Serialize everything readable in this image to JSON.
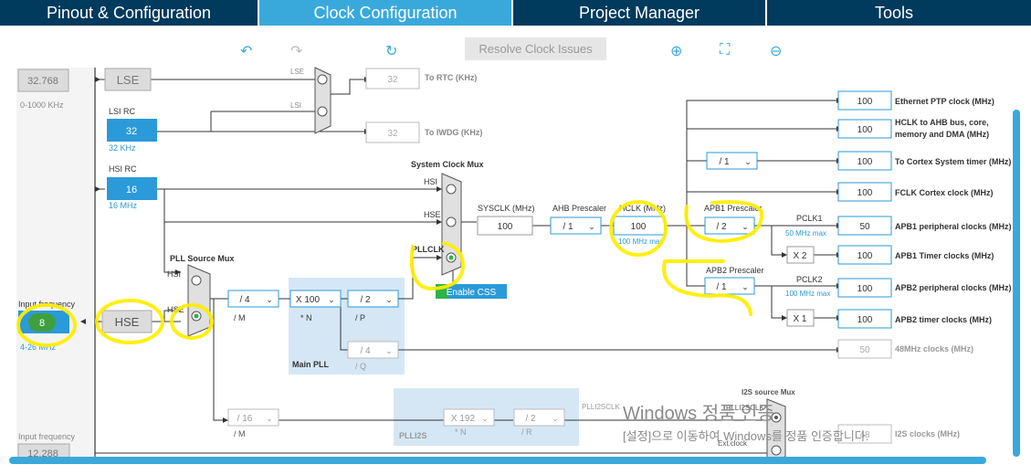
{
  "tabs": [
    {
      "label": "Pinout & Configuration"
    },
    {
      "label": "Clock Configuration"
    },
    {
      "label": "Project Manager"
    },
    {
      "label": "Tools"
    }
  ],
  "toolbar": {
    "resolve_label": "Resolve Clock Issues"
  },
  "lse": {
    "value": "32.768",
    "range": "0-1000 KHz",
    "label": "LSE"
  },
  "lsi": {
    "title": "LSI RC",
    "value": "32",
    "freq": "32 KHz"
  },
  "hsi": {
    "title": "HSI RC",
    "value": "16",
    "freq": "16 MHz"
  },
  "hse": {
    "input_label": "Input frequency",
    "value": "8",
    "range": "4-26 MHz",
    "label": "HSE"
  },
  "i2s_input": {
    "label": "Input frequency",
    "value": "12.288"
  },
  "rtc_mux": {
    "lse": "LSE",
    "lsi": "LSI"
  },
  "rtc": {
    "value": "32",
    "label": "To RTC (KHz)"
  },
  "iwdg": {
    "value": "32",
    "label": "To IWDG (KHz)"
  },
  "pll_source_mux": {
    "title": "PLL Source Mux",
    "hsi": "HSI",
    "hse": "HSE"
  },
  "main_pll": {
    "title": "Main PLL",
    "m": "/ 4",
    "m_label": "/ M",
    "n": "X 100",
    "n_label": "* N",
    "p": "/ 2",
    "p_label": "/ P",
    "q": "/ 4",
    "q_label": "/ Q"
  },
  "sysclk_mux": {
    "title": "System Clock Mux",
    "hsi": "HSI",
    "hse": "HSE",
    "pllclk": "PLLCLK",
    "enable_css": "Enable CSS"
  },
  "sysclk": {
    "label": "SYSCLK (MHz)",
    "value": "100"
  },
  "ahb": {
    "label": "AHB Prescaler",
    "value": "/ 1"
  },
  "hclk": {
    "label": "HCLK (MHz)",
    "value": "100",
    "max": "100 MHz max"
  },
  "apb1": {
    "label": "APB1 Prescaler",
    "value": "/ 2",
    "pclk": "PCLK1",
    "max": "50 MHz max"
  },
  "apb2": {
    "label": "APB2 Prescaler",
    "value": "/ 1",
    "pclk": "PCLK2",
    "max": "100 MHz max"
  },
  "cortex_div": "/ 1",
  "x2": "X 2",
  "x1": "X 1",
  "outputs": [
    {
      "value": "100",
      "label": "Ethernet PTP clock (MHz)"
    },
    {
      "value": "100",
      "label": "HCLK to AHB bus, core,",
      "label2": "memory and DMA (MHz)"
    },
    {
      "value": "100",
      "label": "To Cortex System timer (MHz)"
    },
    {
      "value": "100",
      "label": "FCLK Cortex clock (MHz)"
    },
    {
      "value": "50",
      "label": "APB1 peripheral clocks (MHz)"
    },
    {
      "value": "100",
      "label": "APB1 Timer clocks (MHz)"
    },
    {
      "value": "100",
      "label": "APB2 peripheral clocks (MHz)"
    },
    {
      "value": "100",
      "label": "APB2 timer clocks (MHz)"
    },
    {
      "value": "50",
      "label": "48MHz clocks (MHz)"
    },
    {
      "value": "48",
      "label": "I2S clocks (MHz)"
    }
  ],
  "pll2": {
    "m": "/ 16",
    "m_label": "/ M",
    "title": "PLLI2S",
    "n": "X 192",
    "n_label": "* N",
    "r": "/ 2",
    "r_label": "/ R",
    "clk": "PLLI2SCLK"
  },
  "i2s_mux": {
    "title": "I2S source Mux",
    "pll": "PLLI2SCLK",
    "ext": "Ext.clock"
  },
  "windows": {
    "line1": "Windows 정품 인증",
    "line2": "[설정]으로 이동하여 Windows를 정품 인증합니다."
  },
  "colors": {
    "tab_bar": "#003a5d",
    "tab_active": "#39a9dc",
    "node_blue": "#2b9ad8",
    "highlight": "#ffee00"
  }
}
